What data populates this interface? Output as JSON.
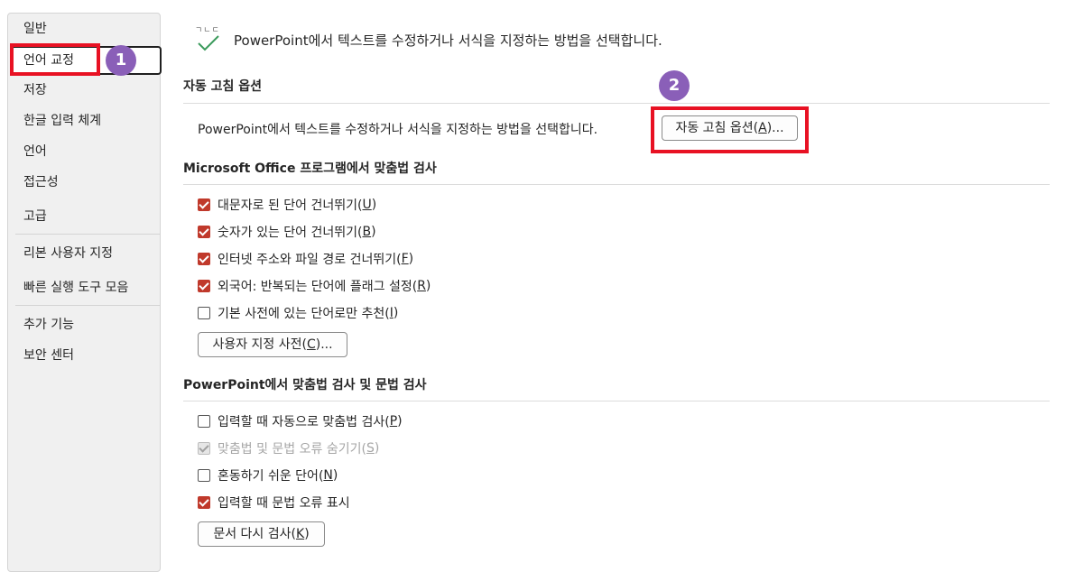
{
  "sidebar": {
    "items": [
      {
        "label": "일반"
      },
      {
        "label": "언어 교정"
      },
      {
        "label": "저장"
      },
      {
        "label": "한글 입력 체계"
      },
      {
        "label": "언어"
      },
      {
        "label": "접근성"
      },
      {
        "label": "고급"
      },
      {
        "label": "리본 사용자 지정"
      },
      {
        "label": "빠른 실행 도구 모음"
      },
      {
        "label": "추가 기능"
      },
      {
        "label": "보안 센터"
      }
    ]
  },
  "badges": {
    "first": "1",
    "second": "2"
  },
  "header": {
    "icon_glyph": "ㄱㄴㄷ",
    "description": "PowerPoint에서 텍스트를 수정하거나 서식을 지정하는 방법을 선택합니다."
  },
  "autocorrect": {
    "title": "자동 고침 옵션",
    "description": "PowerPoint에서 텍스트를 수정하거나 서식을 지정하는 방법을 선택합니다.",
    "button": {
      "pre": "자동 고침 옵션(",
      "key": "A",
      "post": ")..."
    }
  },
  "office_spelling": {
    "title": "Microsoft Office 프로그램에서 맞춤법 검사",
    "options": [
      {
        "pre": "대문자로 된 단어 건너뛰기(",
        "key": "U",
        "post": ")",
        "checked": true
      },
      {
        "pre": "숫자가 있는 단어 건너뛰기(",
        "key": "B",
        "post": ")",
        "checked": true
      },
      {
        "pre": "인터넷 주소와 파일 경로 건너뛰기(",
        "key": "F",
        "post": ")",
        "checked": true
      },
      {
        "pre": "외국어: 반복되는 단어에 플래그 설정(",
        "key": "R",
        "post": ")",
        "checked": true
      },
      {
        "pre": "기본 사전에 있는 단어로만 추천(",
        "key": "I",
        "post": ")",
        "checked": false
      }
    ],
    "button": {
      "pre": "사용자 지정 사전(",
      "key": "C",
      "post": ")..."
    }
  },
  "ppt_spelling": {
    "title": "PowerPoint에서 맞춤법 검사 및 문법 검사",
    "options": [
      {
        "pre": "입력할 때 자동으로 맞춤법 검사(",
        "key": "P",
        "post": ")",
        "checked": false
      },
      {
        "pre": "맞춤법 및 문법 오류 숨기기(",
        "key": "S",
        "post": ")",
        "checked": true,
        "disabled": true
      },
      {
        "pre": "혼동하기 쉬운 단어(",
        "key": "N",
        "post": ")",
        "checked": false
      },
      {
        "pre": "입력할 때 문법 오류 표시",
        "key": "",
        "post": "",
        "checked": true
      }
    ],
    "button": {
      "pre": "문서 다시 검사(",
      "key": "K",
      "post": ")"
    }
  },
  "colors": {
    "accent": "#c0392b",
    "highlight": "#e81123",
    "badge": "#8a5fb8"
  }
}
